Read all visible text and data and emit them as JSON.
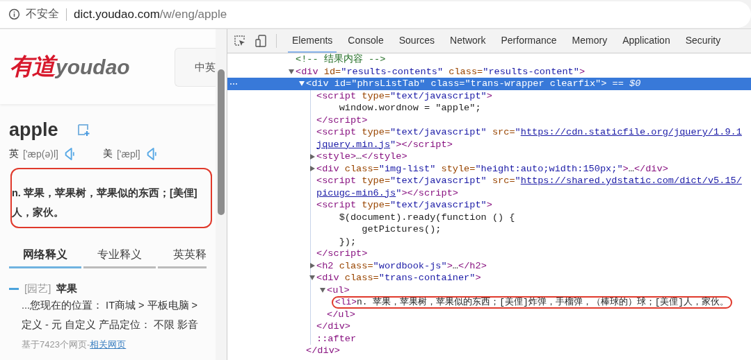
{
  "address_bar": {
    "security": "不安全",
    "domain": "dict.youdao.com",
    "path": "/w/eng/apple"
  },
  "page": {
    "logo": {
      "brand_cn": "有道",
      "brand_en": "youdao"
    },
    "search_lang": "中英",
    "word": "apple",
    "pronunciations": [
      {
        "region": "英",
        "phonetic": "['æp(ə)l]"
      },
      {
        "region": "美",
        "phonetic": "['æpl]"
      }
    ],
    "definition": {
      "circled": true,
      "lines": [
        "n. 苹果，苹果树，苹果似的东西；[美俚]",
        "人，家伙。"
      ]
    },
    "tabs": [
      {
        "label": "网络释义",
        "selected": true
      },
      {
        "label": "专业释义",
        "selected": false
      },
      {
        "label": "英英释",
        "selected": false
      }
    ],
    "web_entry": {
      "domain": "[园艺]",
      "term": "苹果",
      "examples": [
        "...您现在的位置： IT商城 > 平板电脑 >",
        "定义 - 元 自定义 产品定位： 不限 影音"
      ],
      "source": "基于7423个网页-",
      "source_link": "相关网页"
    }
  },
  "devtools": {
    "tabs": [
      {
        "label": "Elements",
        "selected": true
      },
      {
        "label": "Console",
        "selected": false
      },
      {
        "label": "Sources",
        "selected": false
      },
      {
        "label": "Network",
        "selected": false
      },
      {
        "label": "Performance",
        "selected": false
      },
      {
        "label": "Memory",
        "selected": false
      },
      {
        "label": "Application",
        "selected": false
      },
      {
        "label": "Security",
        "selected": false
      }
    ],
    "tree": [
      {
        "kind": "plain",
        "selected": false,
        "lines": [
          [
            {
              "kind": "comment",
              "text": "<!-- 结果内容 -->"
            }
          ]
        ]
      },
      {
        "kind": "toggle",
        "expanded": true,
        "selected": false,
        "lines": [
          [
            {
              "kind": "tag",
              "text": "<div"
            },
            {
              "kind": "attr",
              "text": " id="
            },
            {
              "kind": "value",
              "text": "\"results-contents\""
            },
            {
              "kind": "attr",
              "text": " class="
            },
            {
              "kind": "value",
              "text": "\"results-content\""
            },
            {
              "kind": "tag",
              "text": ">"
            }
          ]
        ],
        "children": [
          {
            "kind": "toggle",
            "expanded": true,
            "selected": true,
            "lines": [
              [
                {
                  "kind": "tag",
                  "text": "<div"
                },
                {
                  "kind": "attr",
                  "text": " id="
                },
                {
                  "kind": "value",
                  "text": "\"phrsListTab\""
                },
                {
                  "kind": "attr",
                  "text": " class="
                },
                {
                  "kind": "value",
                  "text": "\"trans-wrapper clearfix\""
                },
                {
                  "kind": "tag",
                  "text": ">"
                },
                {
                  "kind": "marker",
                  "text": " == "
                },
                {
                  "kind": "var",
                  "text": "$0"
                }
              ]
            ],
            "close": [
              {
                "kind": "tag",
                "text": "</div>"
              }
            ],
            "children": [
              {
                "kind": "plain",
                "selected": false,
                "lines": [
                  [
                    {
                      "kind": "tag",
                      "text": "<script"
                    },
                    {
                      "kind": "attr",
                      "text": " type="
                    },
                    {
                      "kind": "value",
                      "text": "\"text/javascript\""
                    },
                    {
                      "kind": "tag",
                      "text": ">"
                    }
                  ],
                  [
                    {
                      "kind": "text",
                      "text": "    window.wordnow = \"apple\";"
                    }
                  ]
                ],
                "close": [
                  {
                    "kind": "tag",
                    "text": "</script>"
                  }
                ]
              },
              {
                "kind": "plain",
                "selected": false,
                "lines": [
                  [
                    {
                      "kind": "tag",
                      "text": "<script"
                    },
                    {
                      "kind": "attr",
                      "text": " type="
                    },
                    {
                      "kind": "value",
                      "text": "\"text/javascript\""
                    },
                    {
                      "kind": "attr",
                      "text": " src="
                    },
                    {
                      "kind": "value",
                      "text": "\""
                    },
                    {
                      "kind": "link",
                      "text": "https://cdn.staticfile.org/jquery/1.9.1"
                    }
                  ],
                  [
                    {
                      "kind": "link",
                      "text": "jquery.min.js"
                    },
                    {
                      "kind": "value",
                      "text": "\""
                    },
                    {
                      "kind": "tag",
                      "text": "></script>"
                    }
                  ]
                ]
              },
              {
                "kind": "toggle",
                "expanded": false,
                "selected": false,
                "lines": [
                  [
                    {
                      "kind": "tag",
                      "text": "<style>"
                    },
                    {
                      "kind": "text",
                      "text": "…"
                    },
                    {
                      "kind": "tag",
                      "text": "</style>"
                    }
                  ]
                ]
              },
              {
                "kind": "toggle",
                "expanded": false,
                "selected": false,
                "lines": [
                  [
                    {
                      "kind": "tag",
                      "text": "<div"
                    },
                    {
                      "kind": "attr",
                      "text": " class="
                    },
                    {
                      "kind": "value",
                      "text": "\"img-list\""
                    },
                    {
                      "kind": "attr",
                      "text": " style="
                    },
                    {
                      "kind": "value",
                      "text": "\"height:auto;width:150px;\""
                    },
                    {
                      "kind": "tag",
                      "text": ">"
                    },
                    {
                      "kind": "text",
                      "text": "…"
                    },
                    {
                      "kind": "tag",
                      "text": "</div>"
                    }
                  ]
                ]
              },
              {
                "kind": "plain",
                "selected": false,
                "lines": [
                  [
                    {
                      "kind": "tag",
                      "text": "<script"
                    },
                    {
                      "kind": "attr",
                      "text": " type="
                    },
                    {
                      "kind": "value",
                      "text": "\"text/javascript\""
                    },
                    {
                      "kind": "attr",
                      "text": " src="
                    },
                    {
                      "kind": "value",
                      "text": "\""
                    },
                    {
                      "kind": "link",
                      "text": "https://shared.ydstatic.com/dict/v5.15/"
                    }
                  ],
                  [
                    {
                      "kind": "link",
                      "text": "picugc-min6.js"
                    },
                    {
                      "kind": "value",
                      "text": "\""
                    },
                    {
                      "kind": "tag",
                      "text": "></script>"
                    }
                  ]
                ]
              },
              {
                "kind": "plain",
                "selected": false,
                "lines": [
                  [
                    {
                      "kind": "tag",
                      "text": "<script"
                    },
                    {
                      "kind": "attr",
                      "text": " type="
                    },
                    {
                      "kind": "value",
                      "text": "\"text/javascript\""
                    },
                    {
                      "kind": "tag",
                      "text": ">"
                    }
                  ],
                  [
                    {
                      "kind": "text",
                      "text": "    $(document).ready(function () {"
                    }
                  ],
                  [
                    {
                      "kind": "text",
                      "text": "        getPictures();"
                    }
                  ],
                  [
                    {
                      "kind": "text",
                      "text": "    });"
                    }
                  ]
                ],
                "close": [
                  {
                    "kind": "tag",
                    "text": "</script>"
                  }
                ]
              },
              {
                "kind": "toggle",
                "expanded": false,
                "selected": false,
                "lines": [
                  [
                    {
                      "kind": "tag",
                      "text": "<h2"
                    },
                    {
                      "kind": "attr",
                      "text": " class="
                    },
                    {
                      "kind": "value",
                      "text": "\"wordbook-js\""
                    },
                    {
                      "kind": "tag",
                      "text": ">"
                    },
                    {
                      "kind": "text",
                      "text": "…"
                    },
                    {
                      "kind": "tag",
                      "text": "</h2>"
                    }
                  ]
                ]
              },
              {
                "kind": "toggle",
                "expanded": true,
                "selected": false,
                "lines": [
                  [
                    {
                      "kind": "tag",
                      "text": "<div"
                    },
                    {
                      "kind": "attr",
                      "text": " class="
                    },
                    {
                      "kind": "value",
                      "text": "\"trans-container\""
                    },
                    {
                      "kind": "tag",
                      "text": ">"
                    }
                  ]
                ],
                "close": [
                  {
                    "kind": "tag",
                    "text": "</div>"
                  }
                ],
                "children": [
                  {
                    "kind": "toggle",
                    "expanded": true,
                    "selected": false,
                    "lines": [
                      [
                        {
                          "kind": "tag",
                          "text": "<ul>"
                        }
                      ]
                    ],
                    "close": [
                      {
                        "kind": "tag",
                        "text": "</ul>"
                      }
                    ],
                    "children": [
                      {
                        "kind": "plain",
                        "selected": false,
                        "circled": true,
                        "lines": [
                          [
                            {
                              "kind": "tag",
                              "text": "<li>"
                            },
                            {
                              "kind": "text",
                              "text": "n. 苹果，苹果树，苹果似的东西；[美俚]炸弹，手榴弹，（棒球的）球；[美俚]人，家伙。"
                            }
                          ]
                        ]
                      }
                    ]
                  }
                ]
              },
              {
                "kind": "plain",
                "selected": false,
                "lines": [
                  [
                    {
                      "kind": "pseudo",
                      "text": "::after"
                    }
                  ]
                ]
              }
            ]
          }
        ]
      }
    ]
  }
}
